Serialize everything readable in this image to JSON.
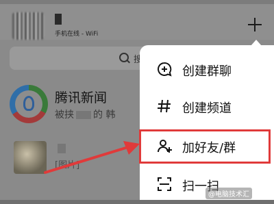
{
  "header": {
    "status_text": "手机在线 - WiFi",
    "add_icon": "plus-icon"
  },
  "search": {
    "placeholder": "搜"
  },
  "conversations": [
    {
      "title": "腾讯新闻",
      "preview_start": "被挟",
      "preview_end": "的 韩"
    },
    {
      "preview": "[图片]"
    }
  ],
  "menu": {
    "items": [
      {
        "label": "创建群聊",
        "icon": "chat-add-icon"
      },
      {
        "label": "创建频道",
        "icon": "hashtag-icon"
      },
      {
        "label": "加好友/群",
        "icon": "add-friend-icon"
      },
      {
        "label": "扫一扫",
        "icon": "scan-icon"
      }
    ]
  },
  "annotation": {
    "highlight_color": "#e03a3a",
    "highlighted_item": "加好友/群"
  },
  "watermark": "@电脑技术汇"
}
